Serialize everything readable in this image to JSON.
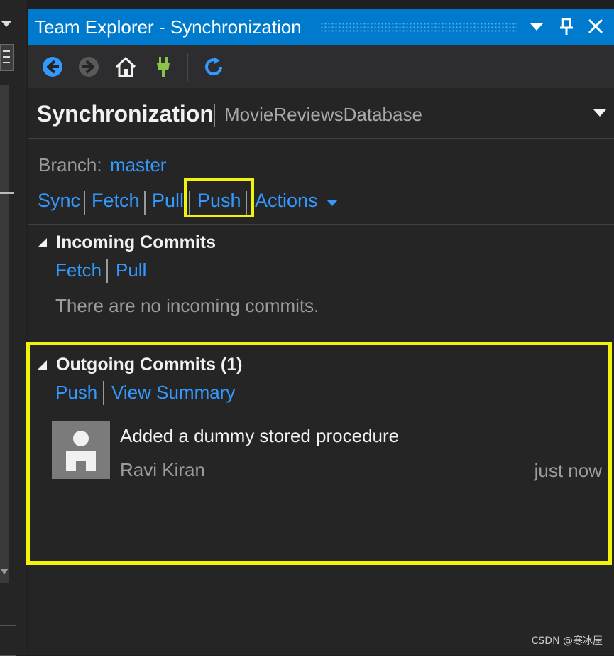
{
  "window": {
    "title": "Team Explorer - Synchronization"
  },
  "toolbar": {
    "buttons": [
      "back-icon",
      "forward-icon",
      "home-icon",
      "connect-icon",
      "refresh-icon"
    ]
  },
  "header": {
    "title": "Synchronization",
    "subtitle": "MovieReviewsDatabase"
  },
  "branch": {
    "label": "Branch:",
    "value": "master"
  },
  "actions": {
    "sync": "Sync",
    "fetch": "Fetch",
    "pull": "Pull",
    "push": "Push",
    "actions": "Actions"
  },
  "incoming": {
    "title": "Incoming Commits",
    "fetch": "Fetch",
    "pull": "Pull",
    "message": "There are no incoming commits."
  },
  "outgoing": {
    "title": "Outgoing Commits (1)",
    "push": "Push",
    "view_summary": "View Summary",
    "commits": [
      {
        "message": "Added a dummy stored procedure",
        "author": "Ravi Kiran",
        "time": "just now"
      }
    ]
  },
  "watermark": "CSDN @寒冰屋",
  "colors": {
    "accent": "#007acc",
    "link": "#3399ff",
    "highlight": "#f2f20a",
    "background": "#252526"
  }
}
